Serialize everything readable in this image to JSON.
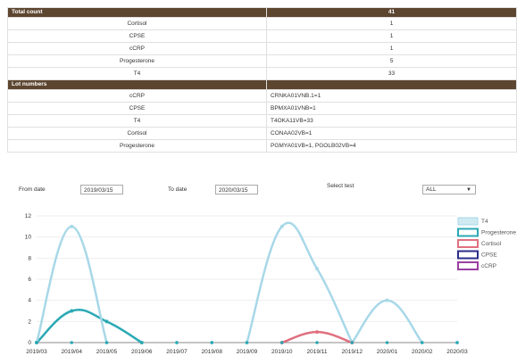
{
  "summary": {
    "header_label": "Total count",
    "header_value": "41",
    "rows": [
      {
        "test": "Cortisol",
        "count": "1"
      },
      {
        "test": "CPSE",
        "count": "1"
      },
      {
        "test": "cCRP",
        "count": "1"
      },
      {
        "test": "Progesterone",
        "count": "5"
      },
      {
        "test": "T4",
        "count": "33"
      }
    ]
  },
  "lots": {
    "header_label": "Lot numbers",
    "rows": [
      {
        "test": "cCRP",
        "lot": "CRNKA01VNB.1=1"
      },
      {
        "test": "CPSE",
        "lot": "BPMXA01VNB=1"
      },
      {
        "test": "T4",
        "lot": "T4OKA11VB=33"
      },
      {
        "test": "Cortisol",
        "lot": "CONAA02VB=1"
      },
      {
        "test": "Progesterone",
        "lot": "PGMYA01VB=1, PGOLB02VB=4"
      }
    ]
  },
  "filters": {
    "from_label": "From date",
    "from_value": "2019/03/15",
    "to_label": "To date",
    "to_value": "2020/03/15",
    "select_label": "Select test",
    "select_value": "ALL"
  },
  "chart_data": {
    "type": "line",
    "categories": [
      "2019/03",
      "2019/04",
      "2019/05",
      "2019/06",
      "2019/07",
      "2019/08",
      "2019/09",
      "2019/10",
      "2019/11",
      "2019/12",
      "2020/01",
      "2020/02",
      "2020/03"
    ],
    "ylim": [
      0,
      12
    ],
    "yticks": [
      0,
      2,
      4,
      6,
      8,
      10,
      12
    ],
    "legend_position": "right",
    "series": [
      {
        "name": "T4",
        "color": "#a8d8e8",
        "values": [
          0,
          11,
          0,
          0,
          0,
          0,
          0,
          11,
          7,
          0,
          4,
          0,
          0
        ]
      },
      {
        "name": "Progesterone",
        "color": "#2aa9b4",
        "values": [
          0,
          3,
          2,
          0,
          0,
          0,
          0,
          0,
          0,
          0,
          0,
          0,
          0
        ]
      },
      {
        "name": "Cortisol",
        "color": "#e07080",
        "values": [
          0,
          0,
          0,
          0,
          0,
          0,
          0,
          0,
          1,
          0,
          0,
          0,
          0
        ]
      },
      {
        "name": "CPSE",
        "color": "#2c2c8c",
        "values": [
          0,
          0,
          0,
          0,
          0,
          0,
          0,
          0,
          0,
          0,
          0,
          0,
          0
        ]
      },
      {
        "name": "cCRP",
        "color": "#9a3fa0",
        "values": [
          0,
          0,
          0,
          0,
          0,
          0,
          0,
          0,
          0,
          0,
          0,
          0,
          0
        ]
      }
    ]
  }
}
